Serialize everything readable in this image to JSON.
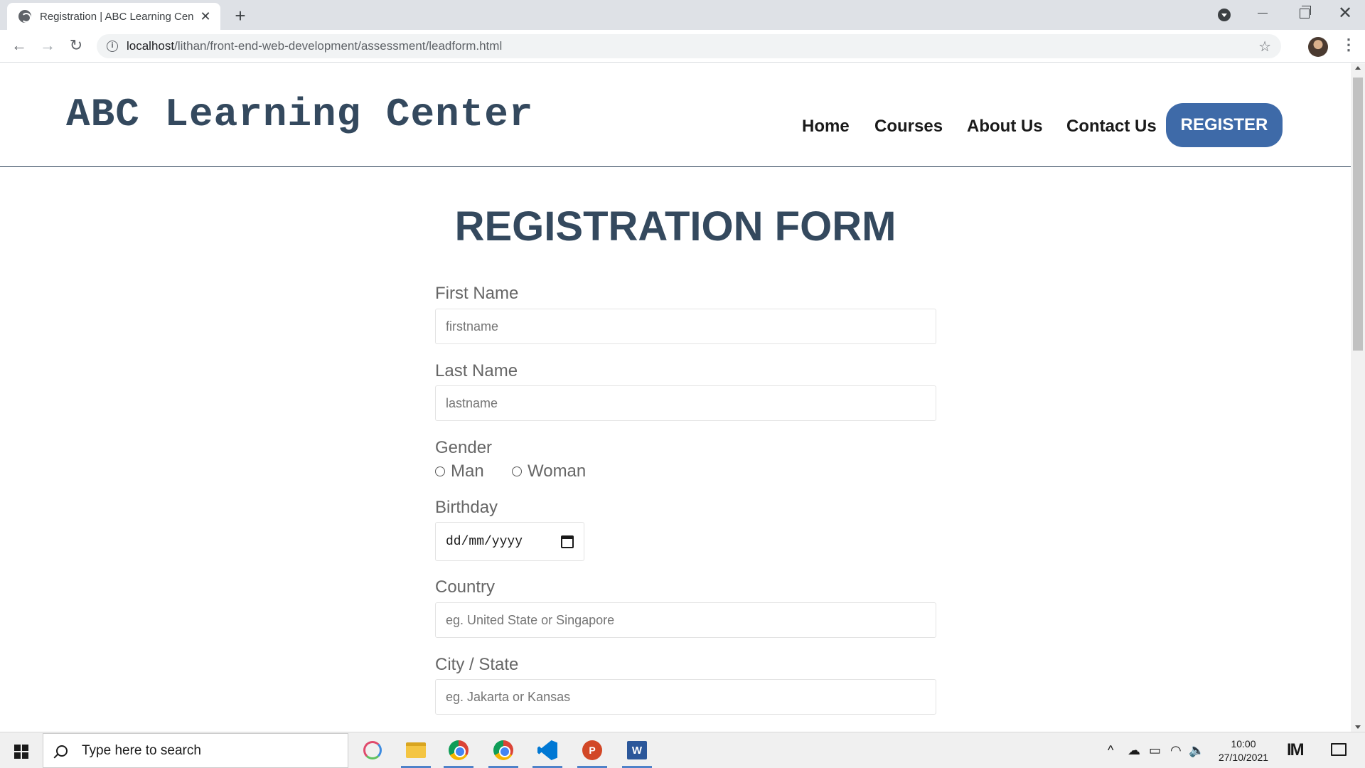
{
  "browser": {
    "tab_title": "Registration | ABC Learning Center",
    "tab_close": "✕",
    "new_tab": "+",
    "url_host": "localhost",
    "url_path": "/lithan/front-end-web-development/assessment/leadform.html",
    "back": "←",
    "forward": "→",
    "reload": "↻",
    "star": "☆",
    "menu": "⋮",
    "close": "✕"
  },
  "site": {
    "brand": "ABC Learning Center",
    "nav": {
      "home": "Home",
      "courses": "Courses",
      "about": "About Us",
      "contact": "Contact Us",
      "register": "REGISTER"
    }
  },
  "form": {
    "title": "REGISTRATION FORM",
    "first_name_label": "First Name",
    "first_name_placeholder": "firstname",
    "last_name_label": "Last Name",
    "last_name_placeholder": "lastname",
    "gender_label": "Gender",
    "gender_options": [
      "Man",
      "Woman"
    ],
    "birthday_label": "Birthday",
    "birthday_placeholder": "dd/mm/yyyy",
    "country_label": "Country",
    "country_placeholder": "eg. United State or Singapore",
    "city_label": "City / State",
    "city_placeholder": "eg. Jakarta or Kansas"
  },
  "taskbar": {
    "search_placeholder": "Type here to search",
    "time": "10:00",
    "date": "27/10/2021",
    "tray_chevron": "^",
    "tray_cloud": "☁",
    "tray_battery": "▭",
    "tray_wifi": "◠",
    "tray_volume": "🔈",
    "tray_app": "IM",
    "ppt_letter": "P",
    "word_letter": "W"
  }
}
